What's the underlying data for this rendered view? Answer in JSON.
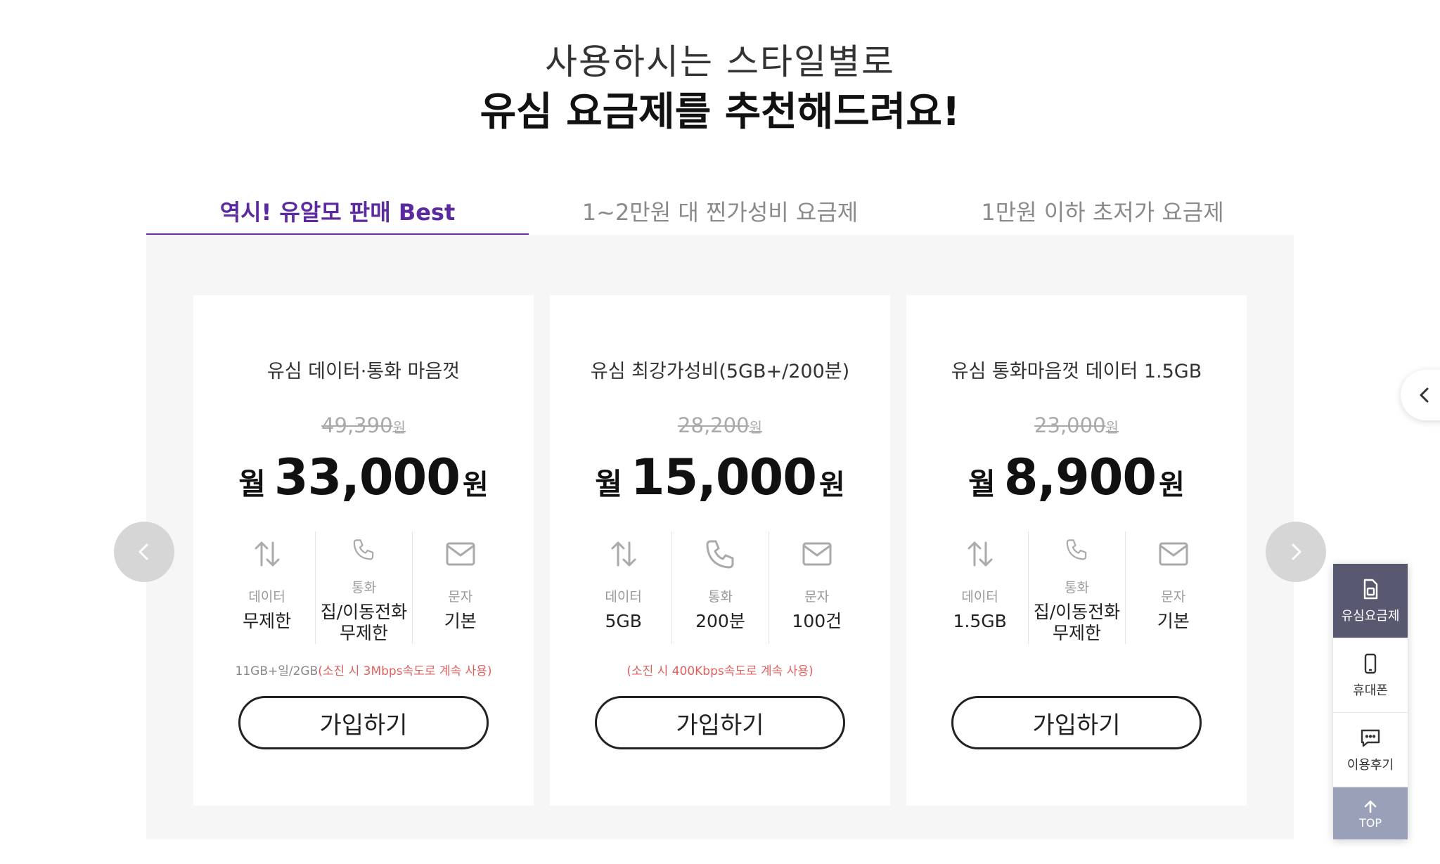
{
  "header": {
    "subtitle": "사용하시는 스타일별로",
    "title": "유심 요금제를 추천해드려요!"
  },
  "tabs": [
    {
      "label": "역시! 유알모 판매 Best"
    },
    {
      "label": "1~2만원 대 찐가성비 요금제"
    },
    {
      "label": "1만원 이하 초저가 요금제"
    }
  ],
  "cards": [
    {
      "name": "유심 데이터·통화 마음껏",
      "original_price": "49,390",
      "price_prefix": "월",
      "price": "33,000",
      "currency": "원",
      "features": [
        {
          "label": "데이터",
          "value": "무제한"
        },
        {
          "label": "통화",
          "value": "집/이동전화 무제한"
        },
        {
          "label": "문자",
          "value": "기본"
        }
      ],
      "note_gray": "11GB+일/2GB",
      "note_red": "(소진 시 3Mbps속도로 계속 사용)",
      "button_label": "가입하기"
    },
    {
      "name": "유심 최강가성비(5GB+/200분)",
      "original_price": "28,200",
      "price_prefix": "월",
      "price": "15,000",
      "currency": "원",
      "features": [
        {
          "label": "데이터",
          "value": "5GB"
        },
        {
          "label": "통화",
          "value": "200분"
        },
        {
          "label": "문자",
          "value": "100건"
        }
      ],
      "note_gray": "",
      "note_red": "(소진 시 400Kbps속도로 계속 사용)",
      "button_label": "가입하기"
    },
    {
      "name": "유심 통화마음껏 데이터 1.5GB",
      "original_price": "23,000",
      "price_prefix": "월",
      "price": "8,900",
      "currency": "원",
      "features": [
        {
          "label": "데이터",
          "value": "1.5GB"
        },
        {
          "label": "통화",
          "value": "집/이동전화 무제한"
        },
        {
          "label": "문자",
          "value": "기본"
        }
      ],
      "note_gray": "",
      "note_red": "",
      "button_label": "가입하기"
    }
  ],
  "quick_menu": [
    {
      "label": "유심요금제",
      "icon": "sim-icon"
    },
    {
      "label": "휴대폰",
      "icon": "phone-icon"
    },
    {
      "label": "이용후기",
      "icon": "review-icon"
    }
  ],
  "top_label": "TOP",
  "colors": {
    "accent": "#6a2c9e",
    "note_red": "#e06060",
    "quick_selected": "#585870",
    "top_bg": "#9aa0b8"
  }
}
